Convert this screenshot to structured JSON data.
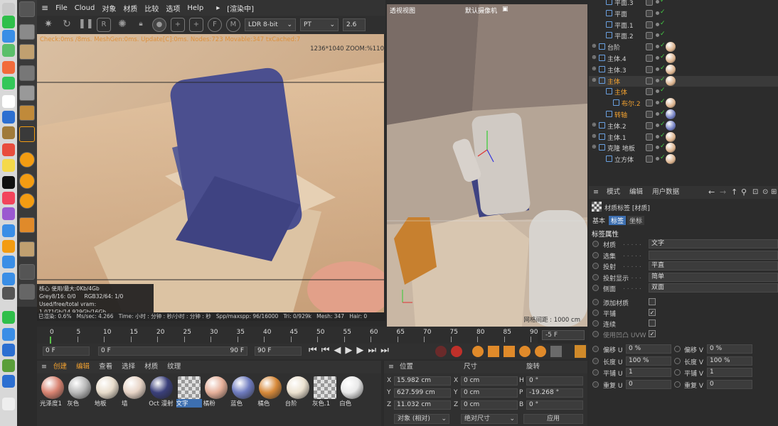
{
  "menubar": {
    "items": [
      "File",
      "Cloud",
      "对象",
      "材质",
      "比较",
      "选项",
      "Help"
    ],
    "render_status": "[渲染中]"
  },
  "render_toolbar": {
    "bitdepth": "LDR 8-bit",
    "mode": "PT",
    "value": "2.6"
  },
  "render_view": {
    "stats_line": "Check:0ms /8ms. MeshGen:0ms. Update[C]:0ms. Nodes:723 Movable:347 txCached:7",
    "resolution": "1236*1040 ZOOM:%110",
    "mem_lines": [
      "核心 使用/最大:0Kb/4Gb",
      "Grey8/16: 0/0",
      "RGB32/64: 1/0",
      "Used/free/total vram: 1.071Gb/14.929Gb/16Gb"
    ],
    "status": {
      "rendered": "已渲染: 0.6%",
      "ms": "Ms/sec: 4.266",
      "time": "Time: 小时 : 分钟 : 秒/小时 : 分钟 : 秒",
      "spp": "Spp/maxspp: 96/16000",
      "tri": "Tri: 0/929k",
      "mesh": "Mesh: 347",
      "hair": "Hair: 0"
    }
  },
  "viewport": {
    "title": "透视视图",
    "camera": "默认摄像机",
    "grid": "网格间距 : 1000 cm"
  },
  "timeline": {
    "ticks": [
      "0",
      "5",
      "10",
      "15",
      "20",
      "25",
      "30",
      "35",
      "40",
      "45",
      "50",
      "55",
      "60",
      "65",
      "70",
      "75",
      "80",
      "85",
      "90"
    ],
    "end_frame": "-5 F"
  },
  "transport": {
    "start": "0 F",
    "current": "0 F",
    "end": "90 F",
    "end2": "90 F"
  },
  "material_manager": {
    "menu": [
      "创建",
      "编辑",
      "查看",
      "选择",
      "材质",
      "纹理"
    ],
    "materials": [
      {
        "label": "光泽度1",
        "color": "#d98472"
      },
      {
        "label": "灰色",
        "color": "#b9b9b9"
      },
      {
        "label": "地板",
        "color": "#e8dccb"
      },
      {
        "label": "墙",
        "color": "#e7d4c6"
      },
      {
        "label": "Oct 漫射",
        "color": "#3a3f7a"
      },
      {
        "label": "文字",
        "color": "#cfcfcf"
      },
      {
        "label": "橘粉",
        "color": "#e6b09a"
      },
      {
        "label": "蓝色",
        "color": "#6f7cc0"
      },
      {
        "label": "橘色",
        "color": "#d88a3a"
      },
      {
        "label": "台阶",
        "color": "#ece2d0"
      },
      {
        "label": "灰色.1",
        "color": "#d0d0d0"
      },
      {
        "label": "白色",
        "color": "#e9e9e9"
      }
    ]
  },
  "coords": {
    "headers": {
      "position": "位置",
      "size": "尺寸",
      "rotation": "旋转"
    },
    "rows": [
      {
        "axis": "X",
        "pos": "15.982 cm",
        "sizeaxis": "X",
        "size": "0 cm",
        "rotaxis": "H",
        "rot": "0 °"
      },
      {
        "axis": "Y",
        "pos": "627.599 cm",
        "sizeaxis": "Y",
        "size": "0 cm",
        "rotaxis": "P",
        "rot": "-19.268 °"
      },
      {
        "axis": "Z",
        "pos": "11.032 cm",
        "sizeaxis": "Z",
        "size": "0 cm",
        "rotaxis": "B",
        "rot": "0 °"
      }
    ],
    "mode": "对象 (相对)",
    "sizemode": "绝对尺寸",
    "apply": "应用"
  },
  "objects": [
    {
      "name": "平面.3",
      "indent": 1,
      "color": "#cfcfcf"
    },
    {
      "name": "平面",
      "indent": 1,
      "color": "#cfcfcf"
    },
    {
      "name": "平面.1",
      "indent": 1,
      "color": "#cfcfcf"
    },
    {
      "name": "平面.2",
      "indent": 1,
      "color": "#cfcfcf"
    },
    {
      "name": "台阶",
      "indent": 0,
      "color": "#cfcfcf"
    },
    {
      "name": "主体.4",
      "indent": 0,
      "color": "#cfcfcf"
    },
    {
      "name": "主体.3",
      "indent": 0,
      "color": "#cfcfcf"
    },
    {
      "name": "主体",
      "indent": 0,
      "color": "#f0a030"
    },
    {
      "name": "主体",
      "indent": 1,
      "color": "#f0a030"
    },
    {
      "name": "布尔.2",
      "indent": 2,
      "color": "#f0a030"
    },
    {
      "name": "转轴",
      "indent": 1,
      "color": "#f0a030"
    },
    {
      "name": "主体.2",
      "indent": 0,
      "color": "#cfcfcf"
    },
    {
      "name": "主体.1",
      "indent": 0,
      "color": "#cfcfcf"
    },
    {
      "name": "克隆 地板",
      "indent": 0,
      "color": "#cfcfcf"
    },
    {
      "name": "立方体",
      "indent": 1,
      "color": "#cfcfcf"
    }
  ],
  "attributes": {
    "menu": [
      "模式",
      "编辑",
      "用户数据"
    ],
    "header": "材质标签 [材质]",
    "tabs": [
      "基本",
      "标签",
      "坐标"
    ],
    "section": "标签属性",
    "rows": [
      {
        "label": "材质",
        "value": "文字"
      },
      {
        "label": "选集",
        "value": ""
      },
      {
        "label": "投射",
        "value": "平直"
      },
      {
        "label": "投射显示",
        "value": "简单"
      },
      {
        "label": "侧面",
        "value": "双面"
      }
    ],
    "checks": [
      {
        "label": "添加材质",
        "checked": false
      },
      {
        "label": "平铺",
        "checked": true
      },
      {
        "label": "连续",
        "checked": false
      },
      {
        "label": "使用凹凸 UVW",
        "checked": true
      }
    ],
    "uv": [
      {
        "l1": "偏移 U",
        "v1": "0 %",
        "l2": "偏移 V",
        "v2": "0 %"
      },
      {
        "l1": "长度 U",
        "v1": "100 %",
        "l2": "长度 V",
        "v2": "100 %"
      },
      {
        "l1": "平铺 U",
        "v1": "1",
        "l2": "平铺 V",
        "v2": "1"
      },
      {
        "l1": "重复 U",
        "v1": "0",
        "l2": "重复 V",
        "v2": "0"
      }
    ]
  }
}
